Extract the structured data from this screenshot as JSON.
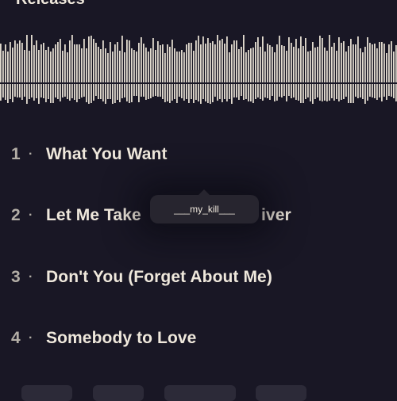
{
  "section": {
    "title": "Releases"
  },
  "tracks": [
    {
      "number": "1",
      "separator": "·",
      "title": "What You Want"
    },
    {
      "number": "2",
      "separator": "·",
      "title": "Let Me Take",
      "title_suffix": "iver"
    },
    {
      "number": "3",
      "separator": "·",
      "title": "Don't You (Forget About Me)"
    },
    {
      "number": "4",
      "separator": "·",
      "title": "Somebody to Love"
    }
  ],
  "tooltip": {
    "text": "___my_kill___"
  },
  "colors": {
    "background": "#191725",
    "text": "#efe8dc",
    "muted": "#b3aea6",
    "waveform": "#e2dbcf",
    "tooltip_bg": "#27252f"
  },
  "icons": {
    "waveform": "waveform-icon"
  }
}
